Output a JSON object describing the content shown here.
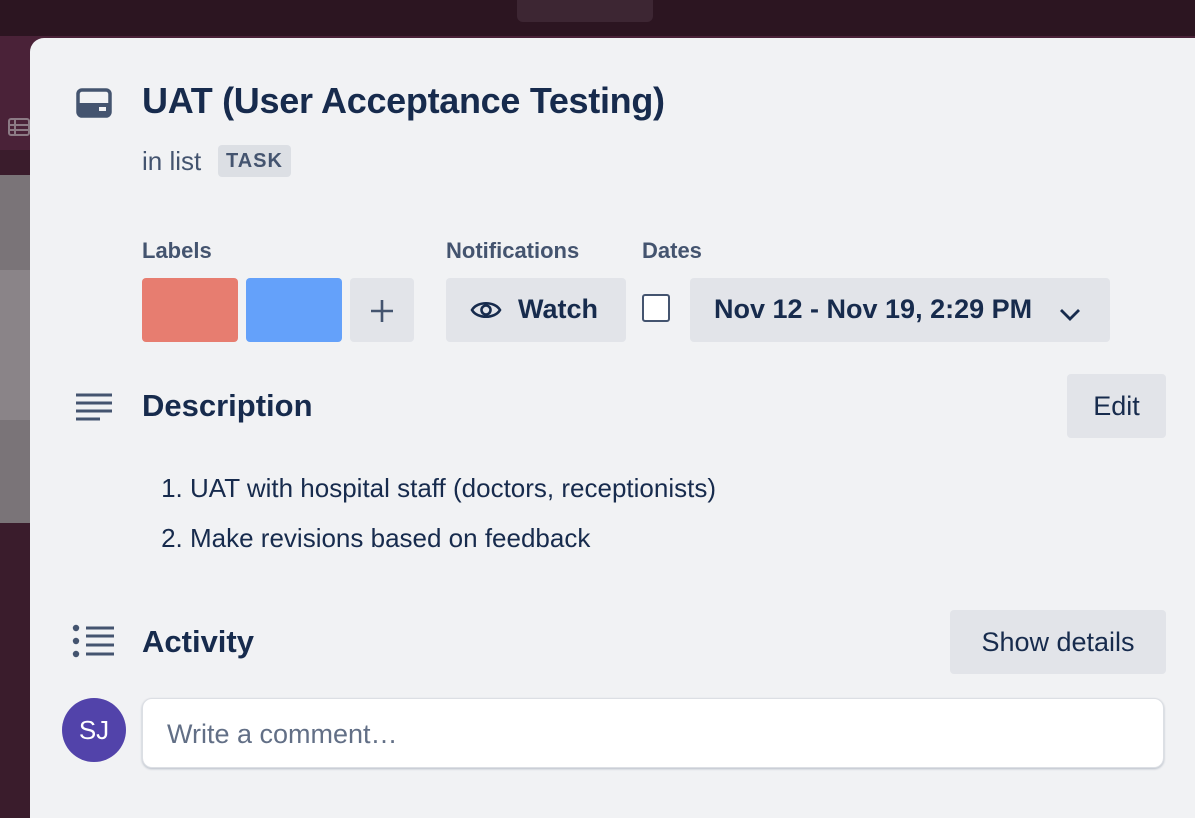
{
  "card": {
    "title": "UAT (User Acceptance Testing)",
    "in_list_text": "in list",
    "list_name": "TASK"
  },
  "labels": {
    "heading": "Labels",
    "items": [
      {
        "color": "#e77d70"
      },
      {
        "color": "#64a1fa"
      }
    ],
    "add_icon": "plus-icon"
  },
  "notifications": {
    "heading": "Notifications",
    "watch_label": "Watch",
    "icon": "eye-icon"
  },
  "dates": {
    "heading": "Dates",
    "value": "Nov 12 - Nov 19, 2:29 PM",
    "completed": false,
    "icon": "chevron-down-icon"
  },
  "description": {
    "heading": "Description",
    "edit_label": "Edit",
    "items": [
      "UAT with hospital staff (doctors, receptionists)",
      "Make revisions based on feedback"
    ],
    "icon": "description-lines-icon"
  },
  "activity": {
    "heading": "Activity",
    "show_details_label": "Show details",
    "icon": "activity-list-icon",
    "avatar_initials": "SJ",
    "avatar_color": "#5243aa",
    "comment_placeholder": "Write a comment…"
  }
}
